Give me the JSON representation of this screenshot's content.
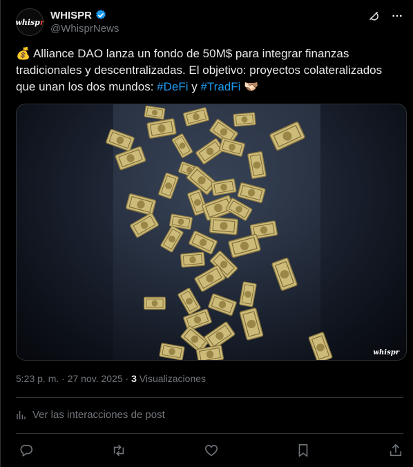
{
  "author": {
    "avatar_text": "whisp",
    "avatar_text_accent": "r",
    "name": "WHISPR",
    "handle": "@WhisprNews",
    "verified_icon": "verified-badge-icon"
  },
  "tweet": {
    "emoji_start": "💰",
    "text_part1": " Alliance DAO lanza un fondo de 50M$ para integrar finanzas tradicionales y descentralizadas. El objetivo: proyectos colateralizados que unan los dos mundos: ",
    "hashtag1": "#DeFi",
    "text_part2": " y ",
    "hashtag2": "#TradFi",
    "emoji_end": " 🫱🏻‍🫲🏽"
  },
  "media": {
    "description_icon": "money-rain-image",
    "watermark": "whispr"
  },
  "meta": {
    "time": "5:23 p. m.",
    "separator": " · ",
    "date": "27 nov. 2025",
    "views_count": "3",
    "views_label": "Visualizaciones"
  },
  "interactions_label": "Ver las interacciones de post",
  "colors": {
    "accent": "#1d9bf0",
    "background": "#000000",
    "text": "#e7e9ea",
    "muted": "#71767b",
    "money": "#c9b873"
  }
}
